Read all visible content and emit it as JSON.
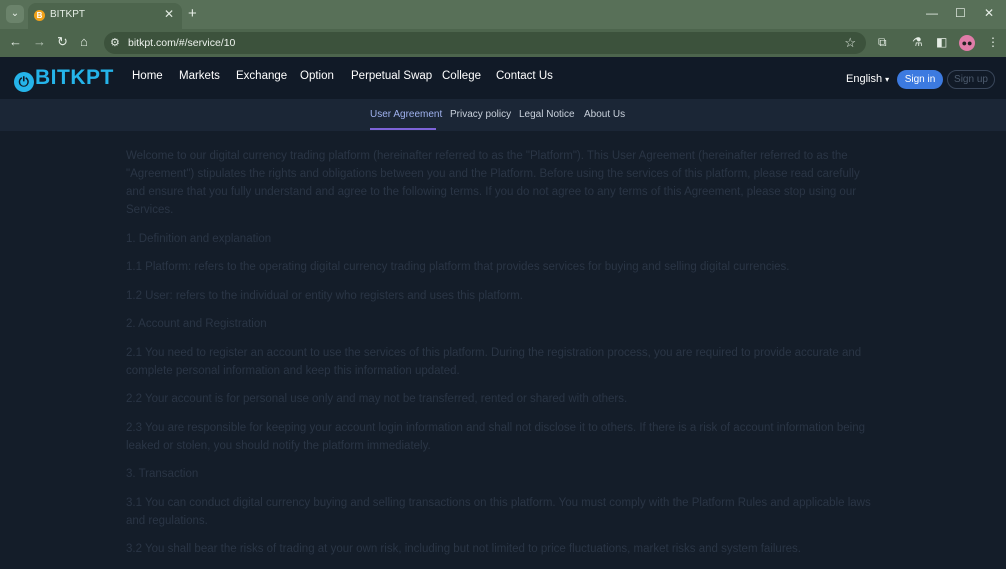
{
  "browser": {
    "tab_title": "BITKPT",
    "url": "bitkpt.com/#/service/10",
    "new_tab": "+",
    "close": "✕"
  },
  "header": {
    "logo_text": "BITKPT",
    "nav": [
      "Home",
      "Markets",
      "Exchange",
      "Option",
      "Perpetual Swap",
      "College",
      "Contact Us"
    ],
    "language": "English",
    "sign_in": "Sign in",
    "sign_up": "Sign up"
  },
  "subnav": {
    "tabs": [
      "User Agreement",
      "Privacy policy",
      "Legal Notice",
      "About Us"
    ],
    "active": "User Agreement"
  },
  "content": {
    "paragraphs": [
      "Welcome to our digital currency trading platform (hereinafter referred to as the \"Platform\"). This User Agreement (hereinafter referred to as the \"Agreement\") stipulates the rights and obligations between you and the Platform. Before using the services of this platform, please read carefully and ensure that you fully understand and agree to the following terms. If you do not agree to any terms of this Agreement, please stop using our Services.",
      "1. Definition and explanation",
      "1.1 Platform: refers to the operating digital currency trading platform that provides services for buying and selling digital currencies.",
      "1.2 User: refers to the individual or entity who registers and uses this platform.",
      "2. Account and Registration",
      "2.1 You need to register an account to use the services of this platform. During the registration process, you are required to provide accurate and complete personal information and keep this information updated.",
      "2.2 Your account is for personal use only and may not be transferred, rented or shared with others.",
      "2.3 You are responsible for keeping your account login information and shall not disclose it to others. If there is a risk of account information being leaked or stolen, you should notify the platform immediately.",
      "3. Transaction",
      "3.1 You can conduct digital currency buying and selling transactions on this platform. You must comply with the Platform Rules and applicable laws and regulations.",
      "3.2 You shall bear the risks of trading at your own risk, including but not limited to price fluctuations, market risks and system failures."
    ]
  }
}
